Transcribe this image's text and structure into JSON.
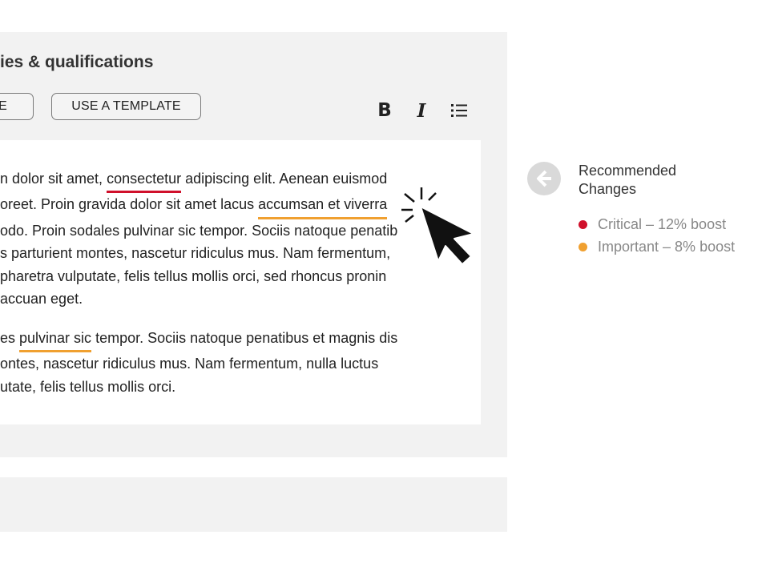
{
  "section": {
    "title": "ies & qualifications"
  },
  "toolbar": {
    "left_button_label": "E",
    "template_button_label": "USE A TEMPLATE",
    "bold_icon": "bold-icon",
    "italic_icon": "italic-icon",
    "list_icon": "bullet-list-icon"
  },
  "editor": {
    "paragraph1": {
      "line1": {
        "before": "n dolor sit amet, ",
        "mark": "consectetur",
        "after": " adipiscing elit. Aenean euismod"
      },
      "line2": {
        "before": "oreet. Proin gravida dolor sit amet lacus ",
        "mark": "accumsan et viverra",
        "after": ""
      },
      "line3": "odo. Proin sodales pulvinar sic tempor. Sociis natoque penatib",
      "line4": "s parturient montes, nascetur ridiculus mus. Nam fermentum,",
      "line5": "pharetra vulputate, felis tellus mollis orci, sed rhoncus pronin",
      "line6": "accuan eget."
    },
    "paragraph2": {
      "line1": {
        "before": "es ",
        "mark": "pulvinar sic",
        "after": " tempor. Sociis natoque penatibus et magnis dis"
      },
      "line2": "ontes, nascetur ridiculus mus. Nam fermentum, nulla luctus",
      "line3": "utate, felis tellus mollis orci."
    }
  },
  "recommendations": {
    "back_icon": "arrow-left-circle-icon",
    "title_line1": "Recommended",
    "title_line2": "Changes",
    "items": [
      {
        "label": "Critical – 12% boost",
        "color": "#d0102b"
      },
      {
        "label": "Important – 8% boost",
        "color": "#f0a030"
      }
    ]
  },
  "colors": {
    "panel_bg": "#f2f2f2",
    "critical": "#d0102b",
    "important": "#f0a030"
  },
  "cursor_icon": "pointer-click-icon"
}
